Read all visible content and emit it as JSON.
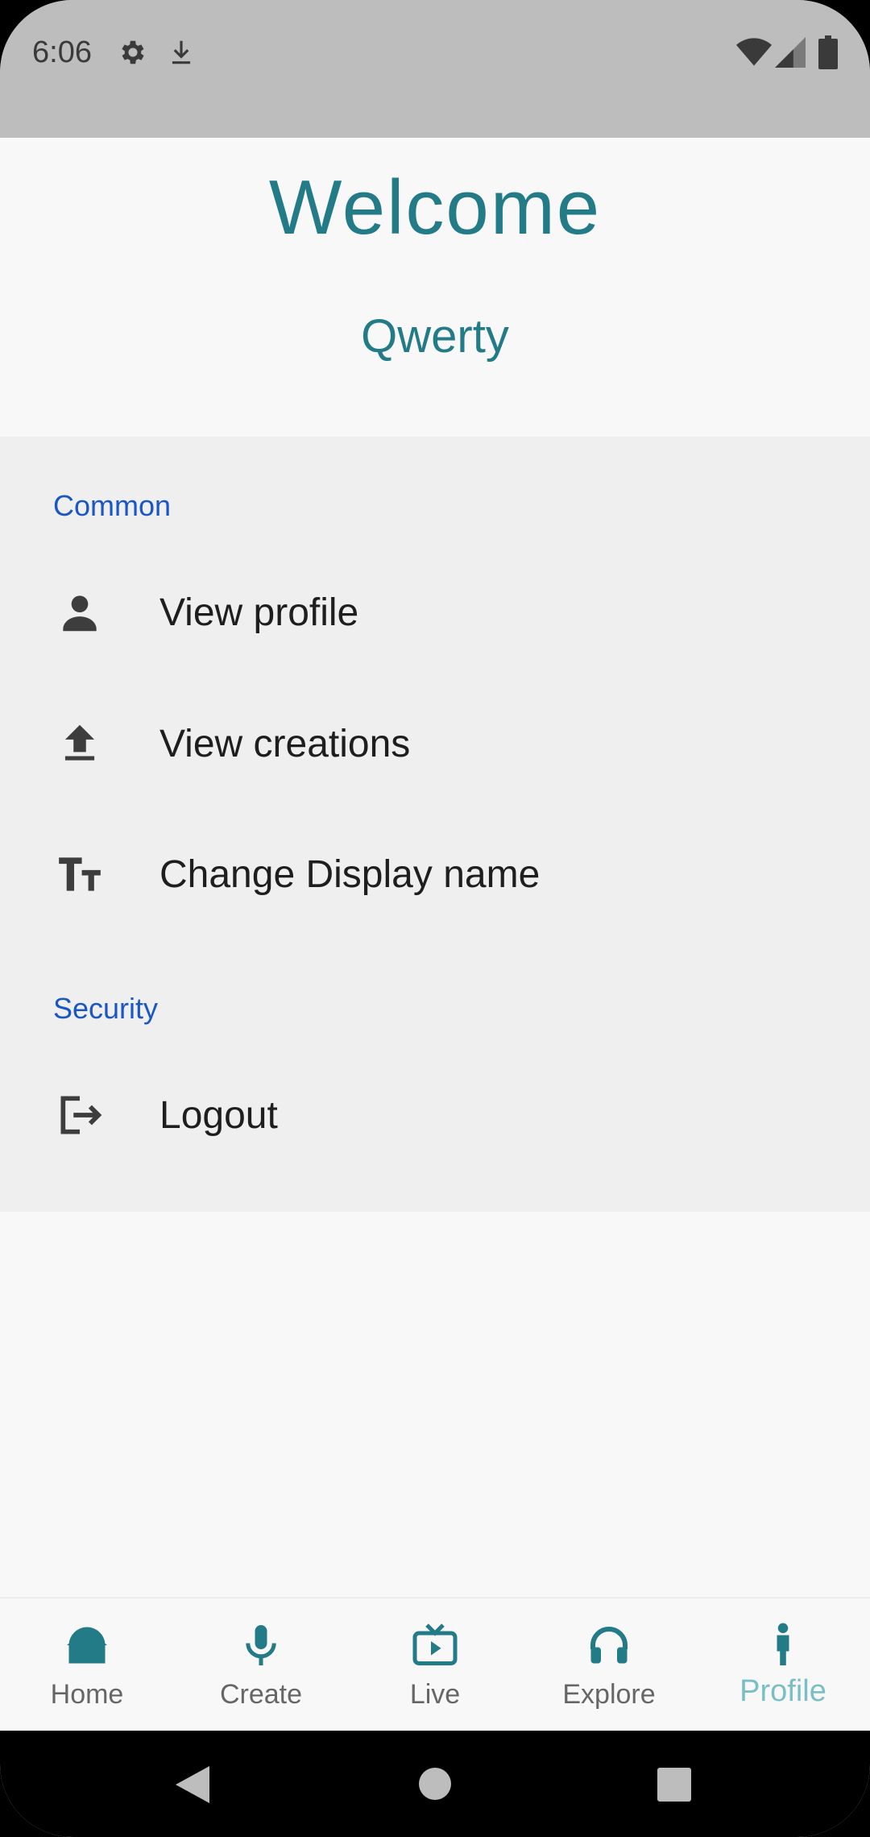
{
  "status_bar": {
    "time": "6:06",
    "icons": [
      "settings-icon",
      "download-icon",
      "wifi-icon",
      "signal-icon",
      "battery-icon"
    ]
  },
  "header": {
    "title": "Welcome",
    "username": "Qwerty"
  },
  "sections": [
    {
      "title": "Common",
      "items": [
        {
          "label": "View profile",
          "icon": "person-icon"
        },
        {
          "label": "View creations",
          "icon": "upload-icon"
        },
        {
          "label": "Change Display name",
          "icon": "text-size-icon"
        }
      ]
    },
    {
      "title": "Security",
      "items": [
        {
          "label": "Logout",
          "icon": "logout-icon"
        }
      ]
    }
  ],
  "bottom_nav": {
    "items": [
      {
        "label": "Home",
        "icon": "home-icon"
      },
      {
        "label": "Create",
        "icon": "mic-icon"
      },
      {
        "label": "Live",
        "icon": "live-tv-icon"
      },
      {
        "label": "Explore",
        "icon": "headphones-icon"
      },
      {
        "label": "Profile",
        "icon": "person-standing-icon"
      }
    ],
    "active": "Profile"
  },
  "colors": {
    "accent": "#227b87",
    "active_nav": "#79bfc4",
    "section_title": "#1a56c4",
    "status_bar": "#bdbdbd",
    "panel": "#efefef"
  }
}
